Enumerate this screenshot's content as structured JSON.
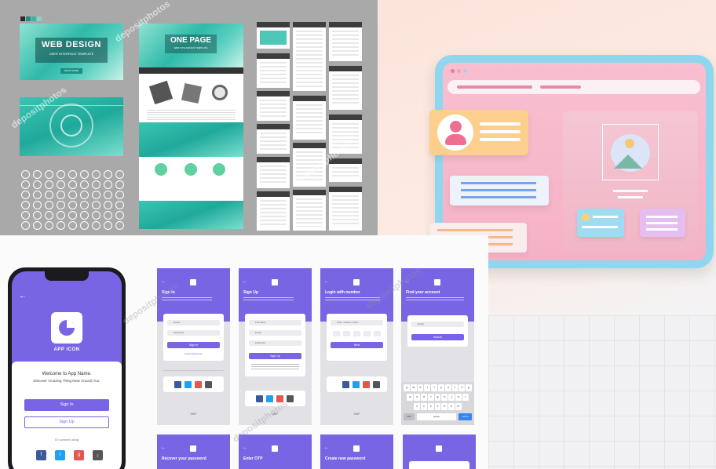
{
  "panel_web_kit": {
    "banner_title": "WEB DESIGN",
    "banner_subtitle": "USER INTERFACE TEMPLATE",
    "banner_button": "READ MORE",
    "onepage_title": "ONE PAGE",
    "onepage_subtitle": "WEB SITE DESIGN TEMPLATE",
    "watermark": "depositphotos"
  },
  "panel_mobile": {
    "phone_app_name": "APP ICON",
    "phone_welcome": "Welcome to App Name.",
    "phone_tagline": "Discover Amazing Thing Near Around You.",
    "phone_signin_button": "Sign In",
    "phone_signup_button": "Sign Up",
    "phone_connect_label": "Or connect using",
    "screens": [
      {
        "title": "Sign In",
        "button": "Sign In",
        "field1": "Email",
        "field2": "Password",
        "link": "Forgot Password?",
        "footer": "SKIP"
      },
      {
        "title": "Sign Up",
        "button": "Sign Up",
        "field1": "Full Name",
        "field2": "Email",
        "field3": "Password",
        "footer": "SKIP"
      },
      {
        "title": "Login with number",
        "button": "Next",
        "field1": "Enter mobile number",
        "footer": "SKIP"
      },
      {
        "title": "Find your account",
        "button": "Search",
        "field1": "Email"
      },
      {
        "title": "Recover your password"
      },
      {
        "title": "Enter OTP"
      },
      {
        "title": "Create new password"
      },
      {
        "title": ""
      }
    ],
    "keyboard_rows": [
      [
        "q",
        "w",
        "e",
        "r",
        "t",
        "y",
        "u",
        "i",
        "o",
        "p"
      ],
      [
        "a",
        "s",
        "d",
        "f",
        "g",
        "h",
        "j",
        "k",
        "l"
      ],
      [
        "z",
        "x",
        "c",
        "v",
        "b",
        "n",
        "m"
      ]
    ],
    "keyboard_keys": {
      "numbers": "123",
      "space": "space",
      "return": "return"
    },
    "social": [
      "f",
      "t",
      "g",
      "in"
    ]
  },
  "colors": {
    "mobile_accent": "#7765e3",
    "web_teal": "#2fb9a9",
    "panel_pink": "#f6b8cc",
    "panel_frame": "#8ed7ef"
  }
}
